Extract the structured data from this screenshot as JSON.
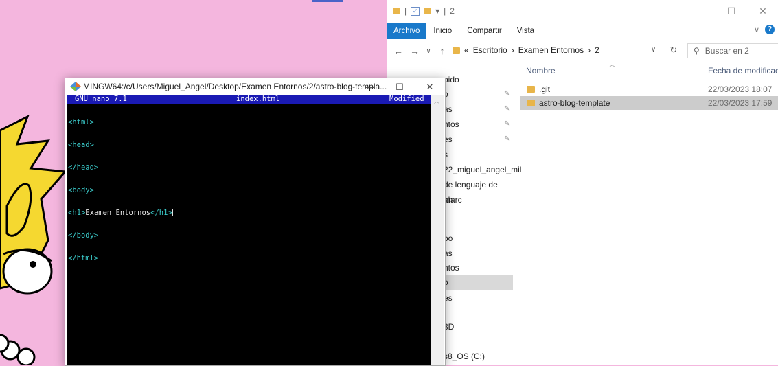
{
  "terminal": {
    "title": "MINGW64:/c/Users/Miguel_Angel/Desktop/Examen Entornos/2/astro-blog-templa...",
    "nano_version": "GNU nano 7.1",
    "file_name": "index.html",
    "status": "Modified",
    "lines": [
      {
        "tag": "<html>",
        "text": "",
        "close": ""
      },
      {
        "tag": "<head>",
        "text": "",
        "close": ""
      },
      {
        "tag": "</head>",
        "text": "",
        "close": ""
      },
      {
        "tag": "<body>",
        "text": "",
        "close": ""
      },
      {
        "tag": "<h1>",
        "text": "Examen Entornos",
        "close": "</h1>"
      },
      {
        "tag": "</body>",
        "text": "",
        "close": ""
      },
      {
        "tag": "</html>",
        "text": "",
        "close": ""
      }
    ],
    "controls": {
      "minimize": "—",
      "maximize": "☐",
      "close": "✕"
    }
  },
  "explorer": {
    "qat_path": "2",
    "ribbon_tabs": [
      "Archivo",
      "Inicio",
      "Compartir",
      "Vista"
    ],
    "breadcrumb": {
      "overflow": "«",
      "items": [
        "Escritorio",
        "Examen Entornos",
        "2"
      ],
      "separator": "›"
    },
    "search_placeholder": "Buscar en 2",
    "controls": {
      "minimize": "—",
      "maximize": "☐",
      "close": "✕"
    },
    "columns": {
      "name": "Nombre",
      "date": "Fecha de modificació"
    },
    "files": [
      {
        "name": ".git",
        "date": "22/03/2023 18:07"
      },
      {
        "name": "astro-blog-template",
        "date": "22/03/2023 17:59"
      }
    ],
    "nav_items": [
      {
        "label": "pido",
        "pinned": false
      },
      {
        "label": "o",
        "pinned": true
      },
      {
        "label": "as",
        "pinned": true
      },
      {
        "label": "ntos",
        "pinned": true
      },
      {
        "label": "es",
        "pinned": true
      },
      {
        "label": "s",
        "pinned": false
      },
      {
        "label": "22_miguel_angel_mil",
        "pinned": false
      },
      {
        "label": "de lenguaje de marc",
        "pinned": false
      },
      {
        "label": "ah",
        "pinned": false
      },
      {
        "label": "oo",
        "pinned": false
      },
      {
        "label": "as",
        "pinned": false
      },
      {
        "label": "ntos",
        "pinned": false
      },
      {
        "label": "o",
        "pinned": false
      },
      {
        "label": "es",
        "pinned": false
      },
      {
        "label": "3D",
        "pinned": false
      },
      {
        "label": "s8_OS (C:)",
        "pinned": false
      }
    ]
  },
  "colors": {
    "desktop": "#f4b6de",
    "nano_header": "#1a1ab4",
    "accent": "#1979ca",
    "html_tag": "#3ac8c8"
  }
}
